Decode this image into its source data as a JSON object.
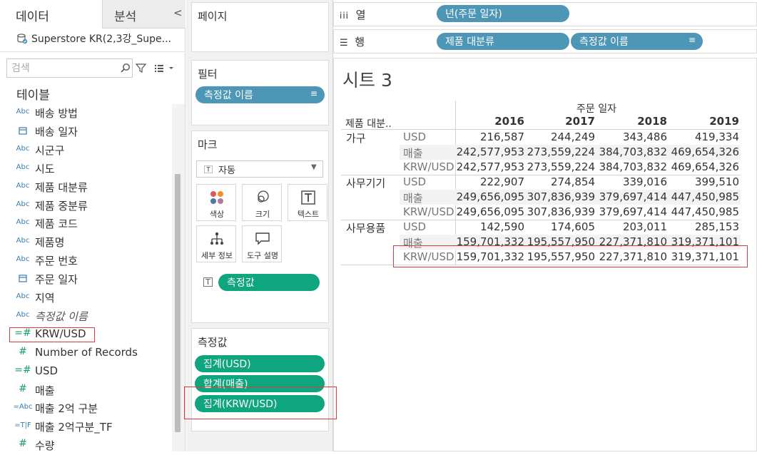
{
  "left_pane": {
    "tab_data": "데이터",
    "tab_analysis": "분석",
    "datasource": "Superstore KR(2,3강_Supe...",
    "search_placeholder": "검색",
    "tables_heading": "테이블",
    "fields": [
      {
        "type": "Abc",
        "name": "배송 방법",
        "kind": "dim"
      },
      {
        "type": "calendar",
        "name": "배송 일자",
        "kind": "date"
      },
      {
        "type": "Abc",
        "name": "시군구",
        "kind": "dim"
      },
      {
        "type": "Abc",
        "name": "시도",
        "kind": "dim"
      },
      {
        "type": "Abc",
        "name": "제품 대분류",
        "kind": "dim"
      },
      {
        "type": "Abc",
        "name": "제품 중분류",
        "kind": "dim"
      },
      {
        "type": "Abc",
        "name": "제품 코드",
        "kind": "dim"
      },
      {
        "type": "Abc",
        "name": "제품명",
        "kind": "dim"
      },
      {
        "type": "Abc",
        "name": "주문 번호",
        "kind": "dim"
      },
      {
        "type": "calendar",
        "name": "주문 일자",
        "kind": "date"
      },
      {
        "type": "Abc",
        "name": "지역",
        "kind": "dim"
      },
      {
        "type": "Abc",
        "name": "측정값 이름",
        "kind": "dim-italic"
      },
      {
        "type": "=#",
        "name": "KRW/USD",
        "kind": "calc-meas"
      },
      {
        "type": "#",
        "name": "Number of Records",
        "kind": "meas"
      },
      {
        "type": "=#",
        "name": "USD",
        "kind": "calc-meas"
      },
      {
        "type": "#",
        "name": "매출",
        "kind": "meas"
      },
      {
        "type": "=Abc",
        "name": "매출 2억 구분",
        "kind": "calc-dim"
      },
      {
        "type": "=T|F",
        "name": "매출 2억구분_TF",
        "kind": "calc-dim"
      },
      {
        "type": "#",
        "name": "수량",
        "kind": "meas"
      }
    ]
  },
  "cards": {
    "pages_title": "페이지",
    "filters_title": "필터",
    "filter_pill": "측정값 이름",
    "marks_title": "마크",
    "mark_type": "자동",
    "mark_buttons": [
      "색상",
      "크기",
      "텍스트",
      "세부 정보",
      "도구 설명"
    ],
    "marks_text_pill": "측정값",
    "measures_title": "측정값",
    "measure_pills": [
      "집계(USD)",
      "합계(매출)",
      "집계(KRW/USD)"
    ]
  },
  "shelves": {
    "columns_label": "열",
    "columns_pill": "년(주문 일자)",
    "rows_label": "행",
    "rows_pills": [
      "제품 대분류",
      "측정값 이름"
    ]
  },
  "view": {
    "sheet_title": "시트 3",
    "header_top": "주문 일자",
    "row_header": "제품 대분..",
    "years": [
      "2016",
      "2017",
      "2018",
      "2019"
    ],
    "groups": [
      {
        "category": "가구",
        "rows": [
          {
            "measure": "USD",
            "values": [
              "216,587",
              "244,249",
              "343,486",
              "419,334"
            ]
          },
          {
            "measure": "매출",
            "values": [
              "242,577,953",
              "273,559,224",
              "384,703,832",
              "469,654,326"
            ]
          },
          {
            "measure": "KRW/USD",
            "values": [
              "242,577,953",
              "273,559,224",
              "384,703,832",
              "469,654,326"
            ]
          }
        ]
      },
      {
        "category": "사무기기",
        "rows": [
          {
            "measure": "USD",
            "values": [
              "222,907",
              "274,854",
              "339,016",
              "399,510"
            ]
          },
          {
            "measure": "매출",
            "values": [
              "249,656,095",
              "307,836,939",
              "379,697,414",
              "447,450,985"
            ]
          },
          {
            "measure": "KRW/USD",
            "values": [
              "249,656,095",
              "307,836,939",
              "379,697,414",
              "447,450,985"
            ]
          }
        ]
      },
      {
        "category": "사무용품",
        "rows": [
          {
            "measure": "USD",
            "values": [
              "142,590",
              "174,605",
              "203,011",
              "285,153"
            ]
          },
          {
            "measure": "매출",
            "values": [
              "159,701,332",
              "195,557,950",
              "227,371,810",
              "319,371,101"
            ]
          },
          {
            "measure": "KRW/USD",
            "values": [
              "159,701,332",
              "195,557,950",
              "227,371,810",
              "319,371,101"
            ]
          }
        ]
      }
    ]
  },
  "colors": {
    "dimension_pill": "#4e96b6",
    "measure_pill": "#0fa57f",
    "highlight_box": "#e03a3a"
  }
}
